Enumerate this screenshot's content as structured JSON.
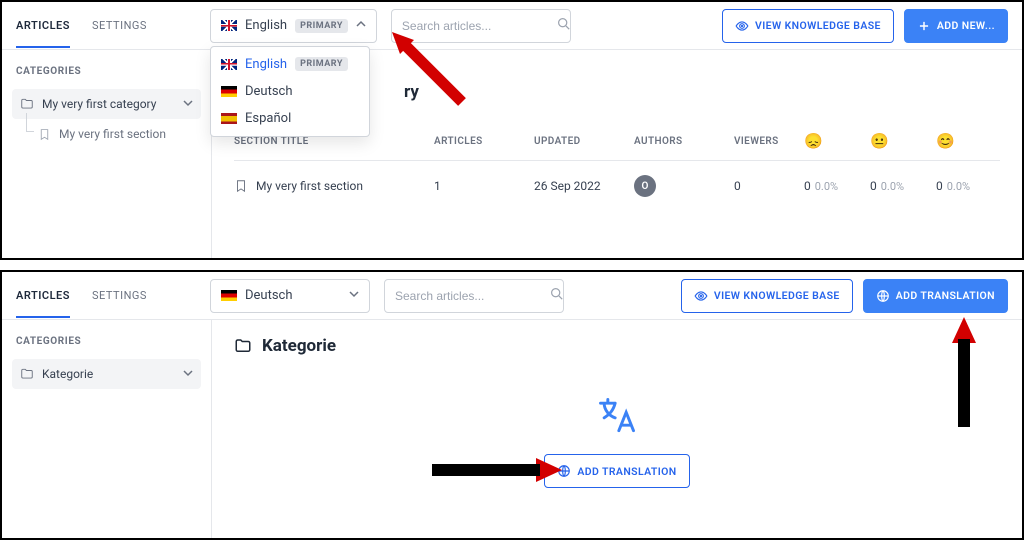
{
  "top": {
    "tabs": {
      "articles": "ARTICLES",
      "settings": "SETTINGS"
    },
    "language": {
      "selected": "English",
      "primary_badge": "PRIMARY",
      "options": [
        {
          "label": "English",
          "flag": "uk",
          "primary": true
        },
        {
          "label": "Deutsch",
          "flag": "de",
          "primary": false
        },
        {
          "label": "Español",
          "flag": "es",
          "primary": false
        }
      ]
    },
    "search_placeholder": "Search articles...",
    "btn_view_kb": "VIEW KNOWLEDGE BASE",
    "btn_add_new": "ADD NEW...",
    "sidebar": {
      "heading": "CATEGORIES",
      "category": "My very first category",
      "section": "My very first section"
    },
    "page_title_partial": "ry",
    "table": {
      "headers": {
        "section_title": "SECTION TITLE",
        "articles": "ARTICLES",
        "updated": "UPDATED",
        "authors": "AUTHORS",
        "viewers": "VIEWERS"
      },
      "row": {
        "title": "My very first section",
        "articles": "1",
        "updated": "26 Sep 2022",
        "author_initial": "O",
        "viewers": "0",
        "sad_count": "0",
        "sad_pct": "0.0%",
        "neutral_count": "0",
        "neutral_pct": "0.0%",
        "happy_count": "0",
        "happy_pct": "0.0%"
      }
    }
  },
  "bottom": {
    "tabs": {
      "articles": "ARTICLES",
      "settings": "SETTINGS"
    },
    "language": {
      "selected": "Deutsch"
    },
    "search_placeholder": "Search articles...",
    "btn_view_kb": "VIEW KNOWLEDGE BASE",
    "btn_add_translation": "ADD TRANSLATION",
    "sidebar": {
      "heading": "CATEGORIES",
      "category": "Kategorie"
    },
    "page_title": "Kategorie",
    "empty_btn": "ADD TRANSLATION"
  }
}
